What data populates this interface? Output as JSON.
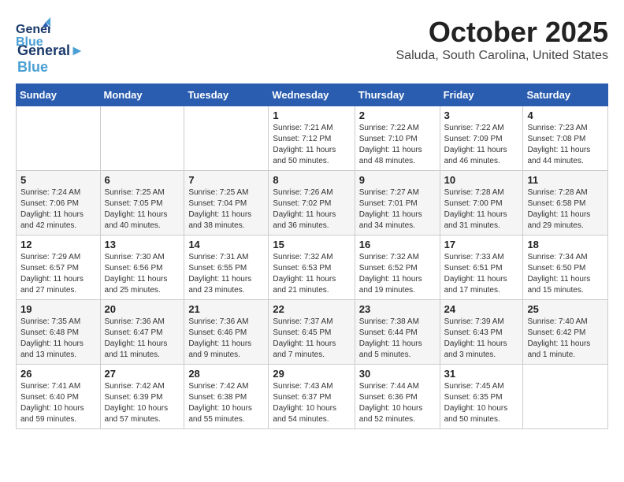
{
  "header": {
    "logo_line1": "General",
    "logo_line2": "Blue",
    "month": "October 2025",
    "location": "Saluda, South Carolina, United States"
  },
  "weekdays": [
    "Sunday",
    "Monday",
    "Tuesday",
    "Wednesday",
    "Thursday",
    "Friday",
    "Saturday"
  ],
  "weeks": [
    [
      {
        "day": "",
        "info": ""
      },
      {
        "day": "",
        "info": ""
      },
      {
        "day": "",
        "info": ""
      },
      {
        "day": "1",
        "info": "Sunrise: 7:21 AM\nSunset: 7:12 PM\nDaylight: 11 hours\nand 50 minutes."
      },
      {
        "day": "2",
        "info": "Sunrise: 7:22 AM\nSunset: 7:10 PM\nDaylight: 11 hours\nand 48 minutes."
      },
      {
        "day": "3",
        "info": "Sunrise: 7:22 AM\nSunset: 7:09 PM\nDaylight: 11 hours\nand 46 minutes."
      },
      {
        "day": "4",
        "info": "Sunrise: 7:23 AM\nSunset: 7:08 PM\nDaylight: 11 hours\nand 44 minutes."
      }
    ],
    [
      {
        "day": "5",
        "info": "Sunrise: 7:24 AM\nSunset: 7:06 PM\nDaylight: 11 hours\nand 42 minutes."
      },
      {
        "day": "6",
        "info": "Sunrise: 7:25 AM\nSunset: 7:05 PM\nDaylight: 11 hours\nand 40 minutes."
      },
      {
        "day": "7",
        "info": "Sunrise: 7:25 AM\nSunset: 7:04 PM\nDaylight: 11 hours\nand 38 minutes."
      },
      {
        "day": "8",
        "info": "Sunrise: 7:26 AM\nSunset: 7:02 PM\nDaylight: 11 hours\nand 36 minutes."
      },
      {
        "day": "9",
        "info": "Sunrise: 7:27 AM\nSunset: 7:01 PM\nDaylight: 11 hours\nand 34 minutes."
      },
      {
        "day": "10",
        "info": "Sunrise: 7:28 AM\nSunset: 7:00 PM\nDaylight: 11 hours\nand 31 minutes."
      },
      {
        "day": "11",
        "info": "Sunrise: 7:28 AM\nSunset: 6:58 PM\nDaylight: 11 hours\nand 29 minutes."
      }
    ],
    [
      {
        "day": "12",
        "info": "Sunrise: 7:29 AM\nSunset: 6:57 PM\nDaylight: 11 hours\nand 27 minutes."
      },
      {
        "day": "13",
        "info": "Sunrise: 7:30 AM\nSunset: 6:56 PM\nDaylight: 11 hours\nand 25 minutes."
      },
      {
        "day": "14",
        "info": "Sunrise: 7:31 AM\nSunset: 6:55 PM\nDaylight: 11 hours\nand 23 minutes."
      },
      {
        "day": "15",
        "info": "Sunrise: 7:32 AM\nSunset: 6:53 PM\nDaylight: 11 hours\nand 21 minutes."
      },
      {
        "day": "16",
        "info": "Sunrise: 7:32 AM\nSunset: 6:52 PM\nDaylight: 11 hours\nand 19 minutes."
      },
      {
        "day": "17",
        "info": "Sunrise: 7:33 AM\nSunset: 6:51 PM\nDaylight: 11 hours\nand 17 minutes."
      },
      {
        "day": "18",
        "info": "Sunrise: 7:34 AM\nSunset: 6:50 PM\nDaylight: 11 hours\nand 15 minutes."
      }
    ],
    [
      {
        "day": "19",
        "info": "Sunrise: 7:35 AM\nSunset: 6:48 PM\nDaylight: 11 hours\nand 13 minutes."
      },
      {
        "day": "20",
        "info": "Sunrise: 7:36 AM\nSunset: 6:47 PM\nDaylight: 11 hours\nand 11 minutes."
      },
      {
        "day": "21",
        "info": "Sunrise: 7:36 AM\nSunset: 6:46 PM\nDaylight: 11 hours\nand 9 minutes."
      },
      {
        "day": "22",
        "info": "Sunrise: 7:37 AM\nSunset: 6:45 PM\nDaylight: 11 hours\nand 7 minutes."
      },
      {
        "day": "23",
        "info": "Sunrise: 7:38 AM\nSunset: 6:44 PM\nDaylight: 11 hours\nand 5 minutes."
      },
      {
        "day": "24",
        "info": "Sunrise: 7:39 AM\nSunset: 6:43 PM\nDaylight: 11 hours\nand 3 minutes."
      },
      {
        "day": "25",
        "info": "Sunrise: 7:40 AM\nSunset: 6:42 PM\nDaylight: 11 hours\nand 1 minute."
      }
    ],
    [
      {
        "day": "26",
        "info": "Sunrise: 7:41 AM\nSunset: 6:40 PM\nDaylight: 10 hours\nand 59 minutes."
      },
      {
        "day": "27",
        "info": "Sunrise: 7:42 AM\nSunset: 6:39 PM\nDaylight: 10 hours\nand 57 minutes."
      },
      {
        "day": "28",
        "info": "Sunrise: 7:42 AM\nSunset: 6:38 PM\nDaylight: 10 hours\nand 55 minutes."
      },
      {
        "day": "29",
        "info": "Sunrise: 7:43 AM\nSunset: 6:37 PM\nDaylight: 10 hours\nand 54 minutes."
      },
      {
        "day": "30",
        "info": "Sunrise: 7:44 AM\nSunset: 6:36 PM\nDaylight: 10 hours\nand 52 minutes."
      },
      {
        "day": "31",
        "info": "Sunrise: 7:45 AM\nSunset: 6:35 PM\nDaylight: 10 hours\nand 50 minutes."
      },
      {
        "day": "",
        "info": ""
      }
    ]
  ]
}
